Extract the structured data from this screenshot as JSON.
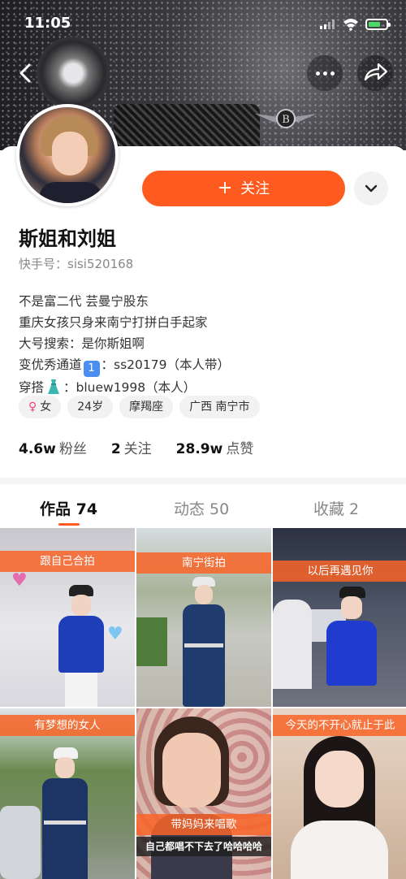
{
  "status_bar": {
    "time": "11:05"
  },
  "profile": {
    "name": "斯姐和刘姐",
    "kuaishou_id": "快手号：sisi520168",
    "follow_label": "关注",
    "bio": {
      "line1": "不是富二代 芸曼宁股东",
      "line2": "重庆女孩只身来南宁打拼白手起家",
      "line3": "大号搜索：是你斯姐啊",
      "line4_prefix": "变优秀通道",
      "line4_emoji": "1",
      "line4_suffix": "：ss20179（本人带）",
      "line5_prefix": "穿搭",
      "line5_suffix": "：bluew1998（本人）"
    },
    "tags": {
      "gender": "女",
      "gender_symbol": "♀",
      "age": "24岁",
      "zodiac": "摩羯座",
      "location": "广西 南宁市"
    },
    "stats": {
      "fans_count": "4.6w",
      "fans_label": "粉丝",
      "following_count": "2",
      "following_label": "关注",
      "likes_count": "28.9w",
      "likes_label": "点赞"
    }
  },
  "tabs": {
    "works": "作品 74",
    "moments": "动态 50",
    "favorites": "收藏 2"
  },
  "videos": [
    {
      "caption": "跟自己合拍"
    },
    {
      "caption": "南宁街拍"
    },
    {
      "caption": "以后再遇见你"
    },
    {
      "caption": "有梦想的女人"
    },
    {
      "caption": "带妈妈来唱歌",
      "subtitle": "自己都唱不下去了哈哈哈哈"
    },
    {
      "caption": "今天的不开心就止于此"
    }
  ],
  "colors": {
    "accent": "#ff5a1f",
    "caption_bg": "#f86428"
  },
  "icons": [
    "back-icon",
    "more-icon",
    "share-icon",
    "chevron-down-icon",
    "plus-icon",
    "female-icon",
    "dress-icon",
    "wifi-icon",
    "signal-icon",
    "battery-icon"
  ]
}
